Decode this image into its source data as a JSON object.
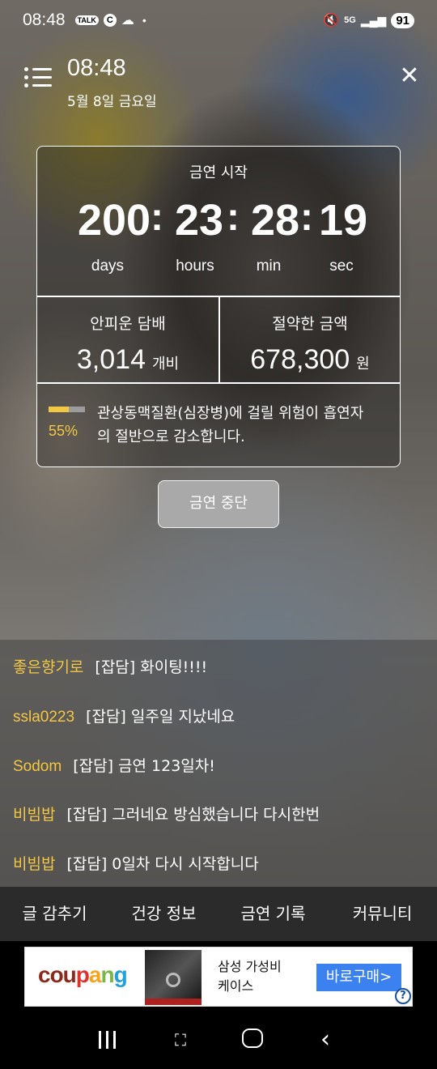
{
  "status_bar": {
    "time": "08:48",
    "left_icons": [
      "talk-icon",
      "c-icon",
      "cloud-icon",
      "dot-icon"
    ],
    "talk_label": "TALK",
    "c_label": "C",
    "right_icons": [
      "mute-icon",
      "5g-icon",
      "signal-icon"
    ],
    "network": "5G",
    "battery": "91"
  },
  "header": {
    "time": "08:48",
    "date": "5월 8일 금요일"
  },
  "card": {
    "title": "금연 시작",
    "days": "200",
    "hours": "23",
    "minutes": "28",
    "seconds": "19",
    "colon": ":",
    "days_label": "days",
    "hours_label": "hours",
    "min_label": "min",
    "sec_label": "sec",
    "cigarettes_label": "안피운 담배",
    "cigarettes_value": "3,014",
    "cigarettes_unit": "개비",
    "saved_label": "절약한 금액",
    "saved_value": "678,300",
    "saved_unit": "원",
    "health_percent": "55%",
    "health_progress": 0.55,
    "health_text": "관상동맥질환(심장병)에 걸릴 위험이 흡연자의 절반으로 감소합니다."
  },
  "stop_button": "금연 중단",
  "chat": [
    {
      "nick": "좋은향기로",
      "msg": "[잡담] 화이팅!!!!"
    },
    {
      "nick": "ssla0223",
      "msg": "[잡담] 일주일 지났네요"
    },
    {
      "nick": "Sodom",
      "msg": "[잡담] 금연 123일차!"
    },
    {
      "nick": "비빔밥",
      "msg": "[잡담] 그러네요 방심했습니다 다시한번"
    },
    {
      "nick": "비빔밥",
      "msg": "[잡담] 0일차 다시 시작합니다"
    }
  ],
  "tabs": [
    "글 감추기",
    "건강 정보",
    "금연 기록",
    "커뮤니티"
  ],
  "ad": {
    "logo": [
      "cou",
      "p",
      "a",
      "n",
      "g"
    ],
    "text_line1": "삼성 가성비",
    "text_line2": "케이스",
    "buy_label": "바로구매>",
    "help_label": "?"
  },
  "colors": {
    "accent_yellow": "#f2c744",
    "tab_bar": "#2b2b2b",
    "ad_button": "#3b82f0"
  }
}
